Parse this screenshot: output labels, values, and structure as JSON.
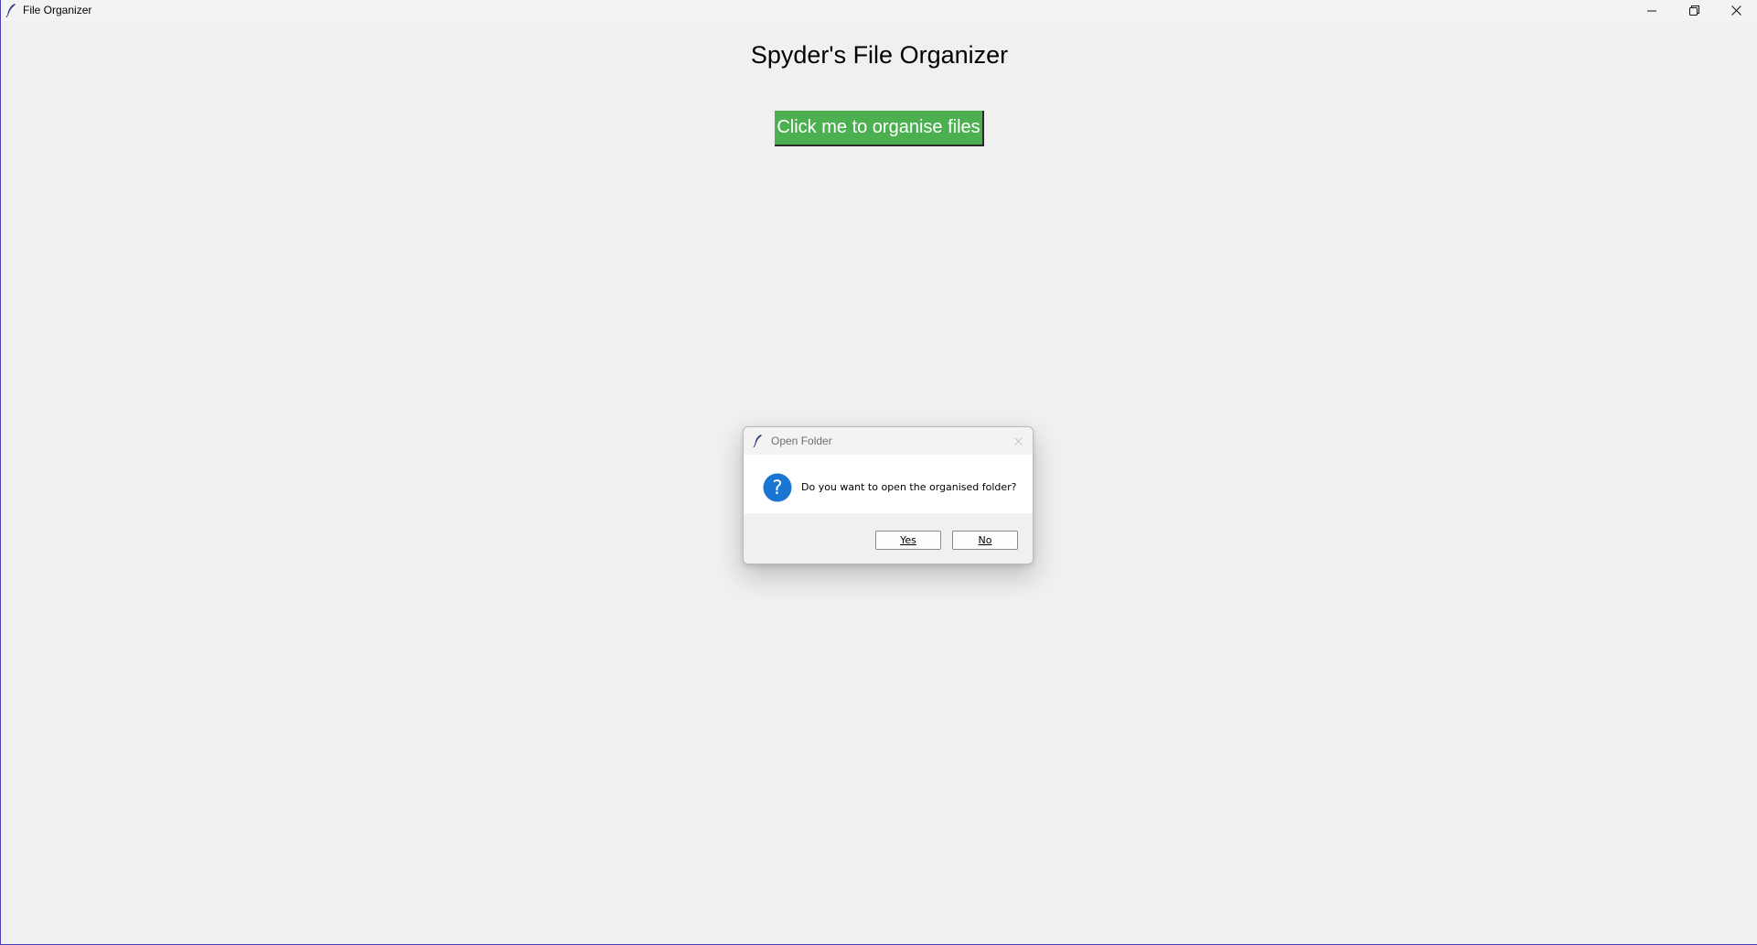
{
  "window": {
    "title": "File Organizer",
    "icon": "feather-icon",
    "controls": {
      "minimize_icon": "minimize-icon",
      "maximize_icon": "restore-icon",
      "close_icon": "close-icon"
    }
  },
  "main": {
    "heading": "Spyder's File Organizer",
    "organise_button_label": "Click me to organise files",
    "organise_button_color": "#4caf50"
  },
  "dialog": {
    "title": "Open Folder",
    "icon": "question-icon",
    "icon_color": "#1976d2",
    "message": "Do you want to open the organised folder?",
    "yes_label": "Yes",
    "no_label": "No"
  }
}
